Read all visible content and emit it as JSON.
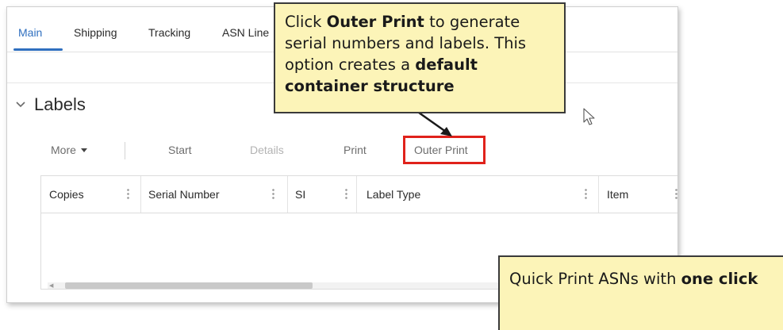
{
  "tabs": [
    {
      "label": "Main",
      "active": true
    },
    {
      "label": "Shipping",
      "active": false
    },
    {
      "label": "Tracking",
      "active": false
    },
    {
      "label": "ASN Line",
      "active": false
    }
  ],
  "section": {
    "title": "Labels",
    "icon": "chevron-down-icon"
  },
  "toolbar": {
    "more_label": "More",
    "start_label": "Start",
    "details_label": "Details",
    "print_label": "Print",
    "outer_print_label": "Outer Print"
  },
  "grid": {
    "columns": [
      "Copies",
      "Serial Number",
      "SI",
      "Label Type",
      "Item"
    ],
    "rows": []
  },
  "callouts": {
    "top": {
      "prefix": "Click ",
      "bold1": "Outer Print",
      "middle": " to generate serial numbers and labels. This option creates a ",
      "bold2": "default container structure"
    },
    "bottom": {
      "prefix": "Quick Print ASNs with ",
      "bold": "one click"
    }
  },
  "colors": {
    "accent": "#2f6fbf",
    "highlight": "#e0221b",
    "callout_fill": "#fcf4b8"
  }
}
